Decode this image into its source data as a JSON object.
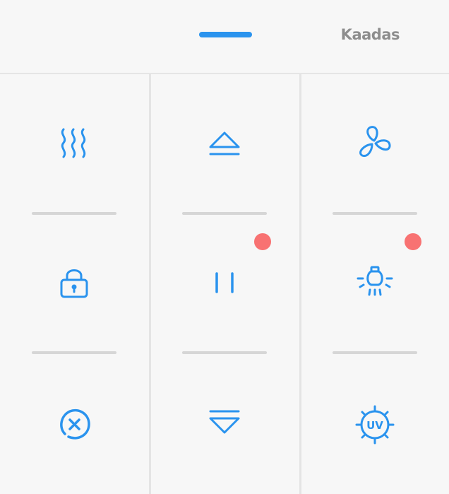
{
  "header": {
    "brand": "Kaadas"
  },
  "controls": [
    {
      "name": "dry",
      "icon": "heat-waves-icon"
    },
    {
      "name": "open",
      "icon": "eject-up-icon"
    },
    {
      "name": "fan",
      "icon": "fan-icon"
    },
    {
      "name": "lock",
      "icon": "lock-icon"
    },
    {
      "name": "pause",
      "icon": "pause-icon",
      "indicator": true
    },
    {
      "name": "light",
      "icon": "lamp-icon",
      "indicator": true
    },
    {
      "name": "cancel",
      "icon": "cancel-icon"
    },
    {
      "name": "close",
      "icon": "close-down-icon"
    },
    {
      "name": "uv",
      "icon": "uv-icon",
      "label": "UV"
    }
  ],
  "colors": {
    "accent": "#2a93ee",
    "indicator": "#f87272",
    "brand_text": "#8d8d8d",
    "separator": "#d6d6d6",
    "background": "#f7f7f7"
  }
}
